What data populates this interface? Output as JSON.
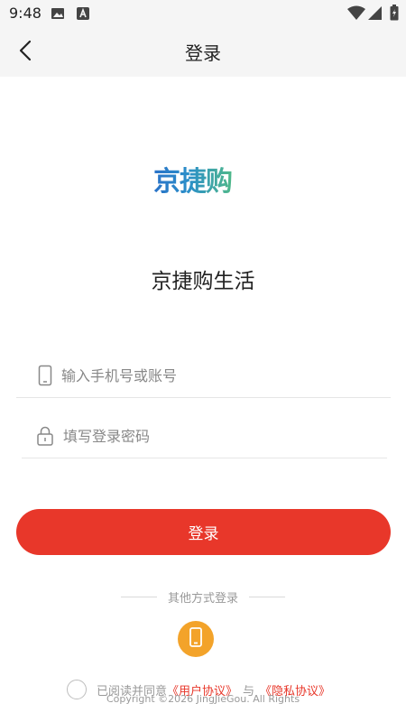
{
  "status_bar": {
    "time": "9:48",
    "icons": [
      "image-icon",
      "a-icon",
      "wifi-icon",
      "signal-icon",
      "battery-icon"
    ]
  },
  "header": {
    "title": "登录",
    "back_icon": "chevron-left-icon"
  },
  "logo": {
    "text": "京捷购"
  },
  "app_name": "京捷购生活",
  "form": {
    "account_placeholder": "输入手机号或账号",
    "password_placeholder": "填写登录密码",
    "account_icon": "phone-outline-icon",
    "password_icon": "lock-icon"
  },
  "login_button": "登录",
  "other_login": {
    "label": "其他方式登录",
    "icon": "phone-icon",
    "icon_bg": "#f3a32a"
  },
  "agreement": {
    "prefix": "已阅读并同意",
    "user_agreement": "《用户协议》",
    "and": "与",
    "privacy_agreement": "《隐私协议》"
  },
  "copyright": "Copyright ©2026 JingJieGou. All Rights",
  "colors": {
    "accent": "#e8372a",
    "header_bg": "#f5f5f5",
    "muted_text": "#999999"
  }
}
